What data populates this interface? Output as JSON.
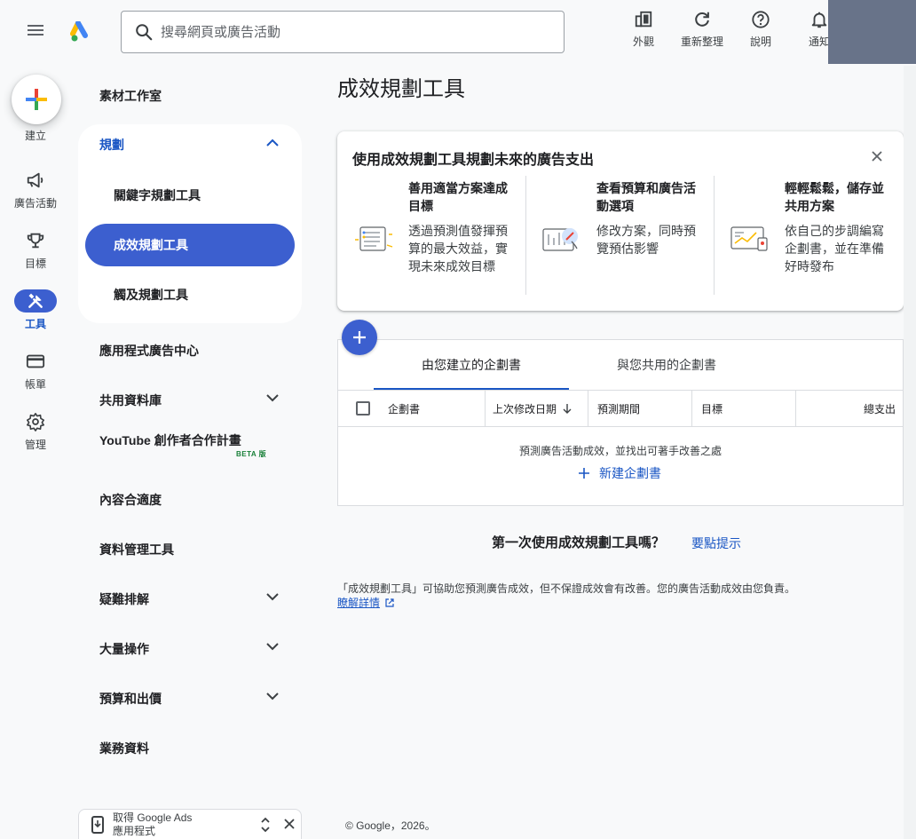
{
  "header": {
    "search_placeholder": "搜尋網頁或廣告活動",
    "actions": [
      {
        "label": "外觀",
        "icon": "appearance-icon"
      },
      {
        "label": "重新整理",
        "icon": "refresh-icon"
      },
      {
        "label": "說明",
        "icon": "help-icon"
      },
      {
        "label": "通知",
        "icon": "notifications-icon"
      }
    ]
  },
  "rail": {
    "create_label": "建立",
    "items": [
      {
        "label": "廣告活動",
        "icon": "megaphone-icon"
      },
      {
        "label": "目標",
        "icon": "trophy-icon"
      },
      {
        "label": "工具",
        "icon": "tools-icon",
        "active": true
      },
      {
        "label": "帳單",
        "icon": "credit-card-icon"
      },
      {
        "label": "管理",
        "icon": "gear-icon"
      }
    ]
  },
  "nav": {
    "asset_studio": "素材工作室",
    "planning": {
      "label": "規劃",
      "items": [
        "關鍵字規劃工具",
        "成效規劃工具",
        "觸及規劃工具"
      ],
      "active_index": 1
    },
    "items": [
      {
        "label": "應用程式廣告中心",
        "chevron": false
      },
      {
        "label": "共用資料庫",
        "chevron": true
      },
      {
        "label": "內容合適度",
        "chevron": false
      },
      {
        "label": "資料管理工具",
        "chevron": false
      },
      {
        "label": "疑難排解",
        "chevron": true
      },
      {
        "label": "大量操作",
        "chevron": true
      },
      {
        "label": "預算和出價",
        "chevron": true
      },
      {
        "label": "業務資料",
        "chevron": false
      }
    ],
    "youtube_program": {
      "label": "YouTube 創作者合作計畫",
      "badge": "BETA 版"
    },
    "app_promo": {
      "line1": "取得 Google Ads",
      "line2": "應用程式"
    }
  },
  "main": {
    "title": "成效規劃工具",
    "info_card": {
      "heading": "使用成效規劃工具規劃未來的廣告支出",
      "tips": [
        {
          "title": "善用適當方案達成目標",
          "desc": "透過預測值發揮預算的最大效益，實現未來成效目標",
          "icon": "checklist-illustration"
        },
        {
          "title": "查看預算和廣告活動選項",
          "desc": "修改方案，同時預覽預估影響",
          "icon": "adjust-chart-illustration"
        },
        {
          "title": "輕輕鬆鬆，儲存並共用方案",
          "desc": "依自己的步調編寫企劃書，並在準備好時發布",
          "icon": "share-chart-illustration"
        }
      ]
    },
    "tabs": [
      "由您建立的企劃書",
      "與您共用的企劃書"
    ],
    "active_tab": 0,
    "columns": [
      "企劃書",
      "上次修改日期",
      "預測期間",
      "目標",
      "總支出"
    ],
    "empty_message": "預測廣告活動成效，並找出可著手改善之處",
    "new_plan_label": "新建企劃書",
    "first_time_question": "第一次使用成效規劃工具嗎？",
    "tips_link": "要點提示",
    "disclaimer": "「成效規劃工具」可協助您預測廣告成效，但不保證成效會有改善。您的廣告活動成效由您負責。",
    "learn_more": "瞭解詳情",
    "footer": "© Google，2026。"
  },
  "colors": {
    "accent": "#3c5fcf",
    "link": "#1a56c4",
    "account_block": "#687389"
  }
}
